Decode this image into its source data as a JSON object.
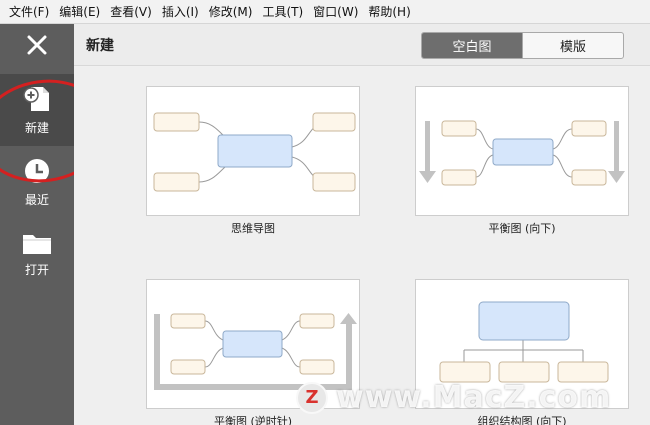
{
  "menu": [
    "文件(F)",
    "编辑(E)",
    "查看(V)",
    "插入(I)",
    "修改(M)",
    "工具(T)",
    "窗口(W)",
    "帮助(H)"
  ],
  "sidebar": {
    "items": [
      {
        "label": "新建",
        "icon": "new-file-icon"
      },
      {
        "label": "最近",
        "icon": "clock-icon"
      },
      {
        "label": "打开",
        "icon": "folder-icon"
      }
    ]
  },
  "header": {
    "title": "新建",
    "toggle": {
      "blank": "空白图",
      "template": "模版",
      "selected": "空白图"
    }
  },
  "templates": [
    {
      "caption": "思维导图"
    },
    {
      "caption": "平衡图 (向下)"
    },
    {
      "caption": "平衡图 (逆时针)"
    },
    {
      "caption": "组织结构图 (向下)"
    }
  ],
  "watermark": {
    "logo": "Z",
    "text": "www.MacZ.com"
  },
  "colors": {
    "sidebar": "#5d5d5d",
    "selected": "#6e6e6e",
    "node_center": "#d6e6fb",
    "node_side": "#fdf6ea",
    "highlight": "#d42020"
  }
}
